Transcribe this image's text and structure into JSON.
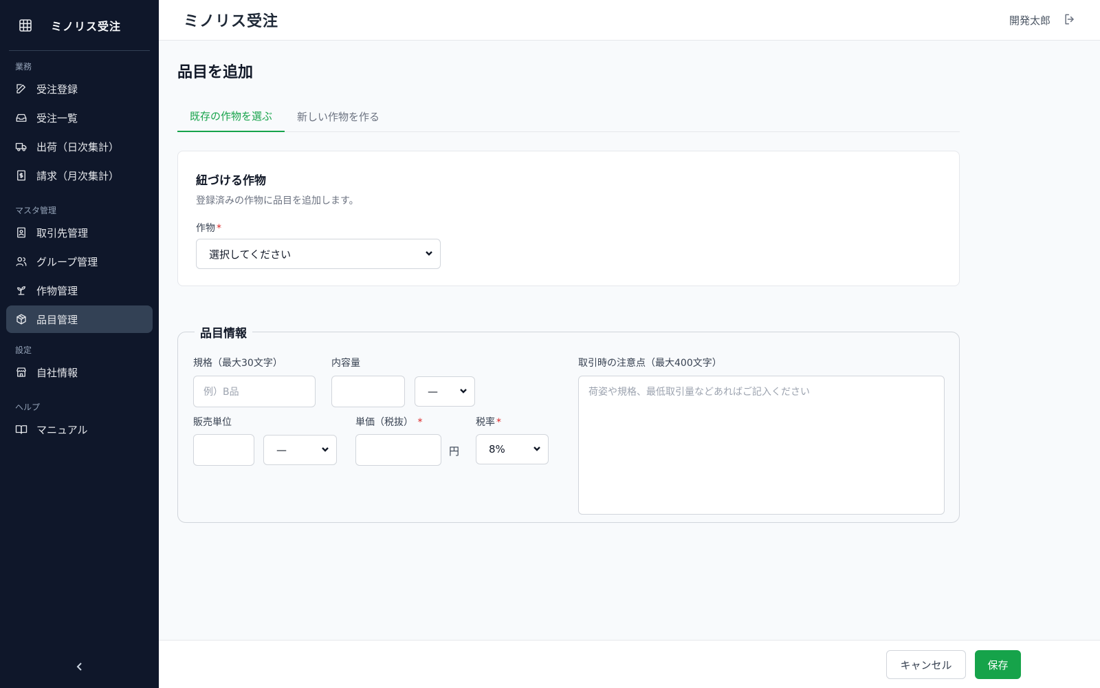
{
  "app": {
    "title": "ミノリス受注"
  },
  "sidebar": {
    "sections": [
      {
        "label": "業務",
        "items": [
          {
            "label": "受注登録",
            "icon": "edit-icon"
          },
          {
            "label": "受注一覧",
            "icon": "inbox-icon"
          },
          {
            "label": "出荷（日次集計）",
            "icon": "truck-icon"
          },
          {
            "label": "請求（月次集計）",
            "icon": "invoice-icon"
          }
        ]
      },
      {
        "label": "マスタ管理",
        "items": [
          {
            "label": "取引先管理",
            "icon": "contact-card-icon"
          },
          {
            "label": "グループ管理",
            "icon": "users-icon"
          },
          {
            "label": "作物管理",
            "icon": "sprout-icon"
          },
          {
            "label": "品目管理",
            "icon": "package-icon",
            "active": true
          }
        ]
      },
      {
        "label": "設定",
        "items": [
          {
            "label": "自社情報",
            "icon": "store-icon"
          }
        ]
      },
      {
        "label": "ヘルプ",
        "items": [
          {
            "label": "マニュアル",
            "icon": "book-icon"
          }
        ]
      }
    ]
  },
  "header": {
    "title": "ミノリス受注",
    "user_name": "開発太郎"
  },
  "page": {
    "title": "品目を追加",
    "tabs": [
      {
        "label": "既存の作物を選ぶ",
        "active": true
      },
      {
        "label": "新しい作物を作る",
        "active": false
      }
    ]
  },
  "crop_card": {
    "title": "紐づける作物",
    "description": "登録済みの作物に品目を追加します。",
    "field_label": "作物",
    "required_mark": "*",
    "select_value": "選択してください"
  },
  "item_info": {
    "legend": "品目情報",
    "spec_label": "規格（最大30文字）",
    "spec_placeholder": "例）B品",
    "content_label": "内容量",
    "content_unit_value": "—",
    "sales_unit_label": "販売単位",
    "sales_unit_value": "—",
    "price_label": "単価（税抜）",
    "price_required": "*",
    "price_suffix": "円",
    "tax_label": "税率",
    "tax_required": "*",
    "tax_value": "8%",
    "notes_label": "取引時の注意点（最大400文字）",
    "notes_placeholder": "荷姿や規格、最低取引量などあればご記入ください"
  },
  "footer": {
    "cancel_label": "キャンセル",
    "save_label": "保存"
  },
  "colors": {
    "sidebar_bg": "#0f172a",
    "accent": "#16a34a",
    "required": "#dc2626"
  }
}
